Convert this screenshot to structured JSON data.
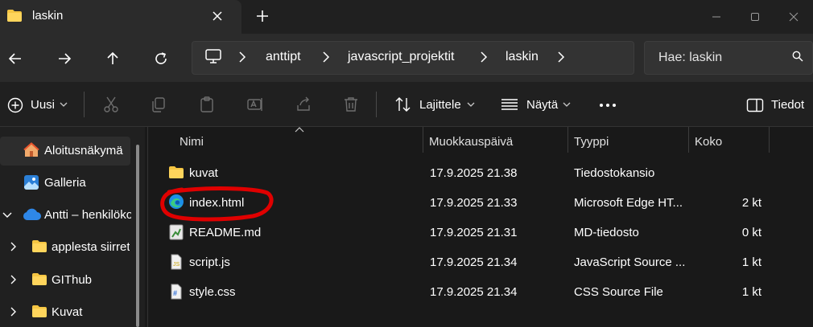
{
  "window": {
    "tab_title": "laskin",
    "tab_close_icon": "close-icon",
    "new_tab_icon": "plus-icon"
  },
  "nav": {
    "breadcrumb": [
      "anttipt",
      "javascript_projektit",
      "laskin"
    ],
    "search_placeholder": "Hae: laskin"
  },
  "toolbar": {
    "new_label": "Uusi",
    "sort_label": "Lajittele",
    "view_label": "Näytä",
    "details_label": "Tiedot"
  },
  "sidebar": {
    "items": [
      {
        "label": "Aloitusnäkymä",
        "icon": "home-icon",
        "selected": true
      },
      {
        "label": "Galleria",
        "icon": "gallery-icon"
      },
      {
        "label": "Antti – henkilökohtainen",
        "icon": "onedrive-cloud-icon",
        "expanded": true
      },
      {
        "label": "applesta siirretyt",
        "icon": "folder-icon"
      },
      {
        "label": "GIThub",
        "icon": "folder-icon"
      },
      {
        "label": "Kuvat",
        "icon": "folder-icon"
      }
    ]
  },
  "columns": {
    "name": "Nimi",
    "modified": "Muokkauspäivä",
    "type": "Tyyppi",
    "size": "Koko"
  },
  "files": [
    {
      "name": "kuvat",
      "date": "17.9.2025 21.38",
      "type": "Tiedostokansio",
      "size": "",
      "icon": "folder-icon"
    },
    {
      "name": "index.html",
      "date": "17.9.2025 21.33",
      "type": "Microsoft Edge HT...",
      "size": "2 kt",
      "icon": "edge-html-icon",
      "annotated": true
    },
    {
      "name": "README.md",
      "date": "17.9.2025 21.31",
      "type": "MD-tiedosto",
      "size": "0 kt",
      "icon": "markdown-file-icon"
    },
    {
      "name": "script.js",
      "date": "17.9.2025 21.34",
      "type": "JavaScript Source ...",
      "size": "1 kt",
      "icon": "js-file-icon"
    },
    {
      "name": "style.css",
      "date": "17.9.2025 21.34",
      "type": "CSS Source File",
      "size": "1 kt",
      "icon": "css-file-icon"
    }
  ],
  "colors": {
    "folder": "#f5c542",
    "annotation": "#e00000",
    "edge_blue": "#1b8ee8",
    "edge_green": "#3ccb7f"
  }
}
